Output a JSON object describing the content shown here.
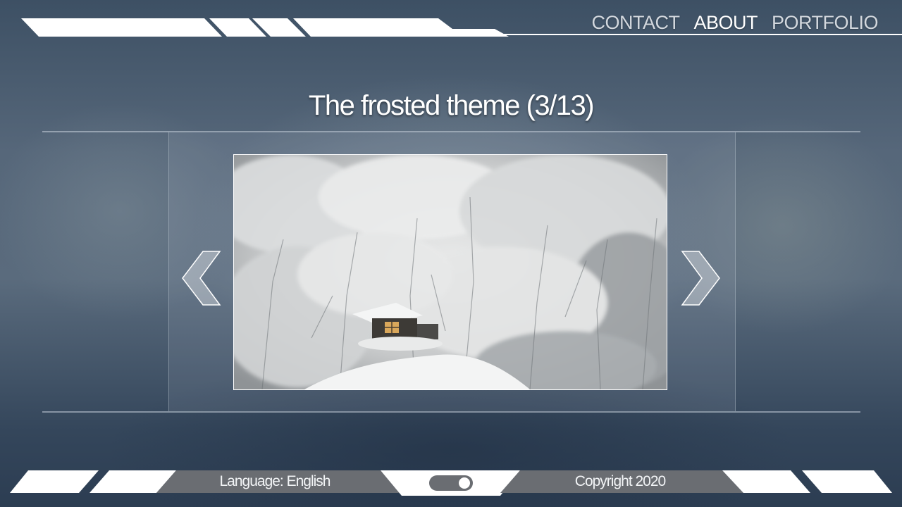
{
  "nav": {
    "items": [
      {
        "label": "CONTACT",
        "active": false
      },
      {
        "label": "ABOUT",
        "active": true
      },
      {
        "label": "PORTFOLIO",
        "active": false
      }
    ]
  },
  "slideshow": {
    "title": "The frosted theme (3/13)",
    "current": 3,
    "total": 13,
    "prev_icon": "chevron-left-icon",
    "next_icon": "chevron-right-icon"
  },
  "footer": {
    "language_label": "Language: English",
    "copyright": "Copyright 2020",
    "toggle_on": true
  },
  "colors": {
    "background": "#4f6174",
    "accent": "#ffffff",
    "footer_tab": "#6a6d72"
  }
}
